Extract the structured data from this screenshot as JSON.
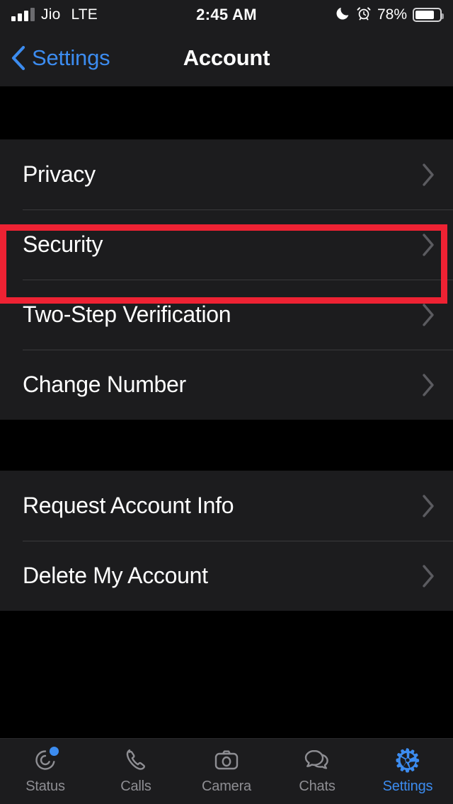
{
  "status_bar": {
    "carrier": "Jio",
    "radio": "LTE",
    "time": "2:45 AM",
    "battery_percent": "78%",
    "icons": [
      "signal-bars-icon",
      "moon-icon",
      "alarm-icon",
      "battery-icon"
    ]
  },
  "nav": {
    "back_label": "Settings",
    "title": "Account",
    "back_icon": "chevron-left-icon",
    "accent_color": "#3c8cf0"
  },
  "highlight": {
    "target": "Privacy",
    "color": "#ee2233"
  },
  "groups": [
    {
      "rows": [
        {
          "label": "Privacy",
          "accessory": "chevron-right-icon",
          "highlighted": true
        },
        {
          "label": "Security",
          "accessory": "chevron-right-icon",
          "highlighted": false
        },
        {
          "label": "Two-Step Verification",
          "accessory": "chevron-right-icon",
          "highlighted": false
        },
        {
          "label": "Change Number",
          "accessory": "chevron-right-icon",
          "highlighted": false
        }
      ]
    },
    {
      "rows": [
        {
          "label": "Request Account Info",
          "accessory": "chevron-right-icon",
          "highlighted": false
        },
        {
          "label": "Delete My Account",
          "accessory": "chevron-right-icon",
          "highlighted": false
        }
      ]
    }
  ],
  "tabbar": {
    "active": "Settings",
    "items": [
      {
        "label": "Status",
        "icon": "status-rings-icon",
        "badge": true
      },
      {
        "label": "Calls",
        "icon": "phone-icon",
        "badge": false
      },
      {
        "label": "Camera",
        "icon": "camera-icon",
        "badge": false
      },
      {
        "label": "Chats",
        "icon": "chat-bubbles-icon",
        "badge": false
      },
      {
        "label": "Settings",
        "icon": "gear-icon",
        "badge": false
      }
    ]
  }
}
